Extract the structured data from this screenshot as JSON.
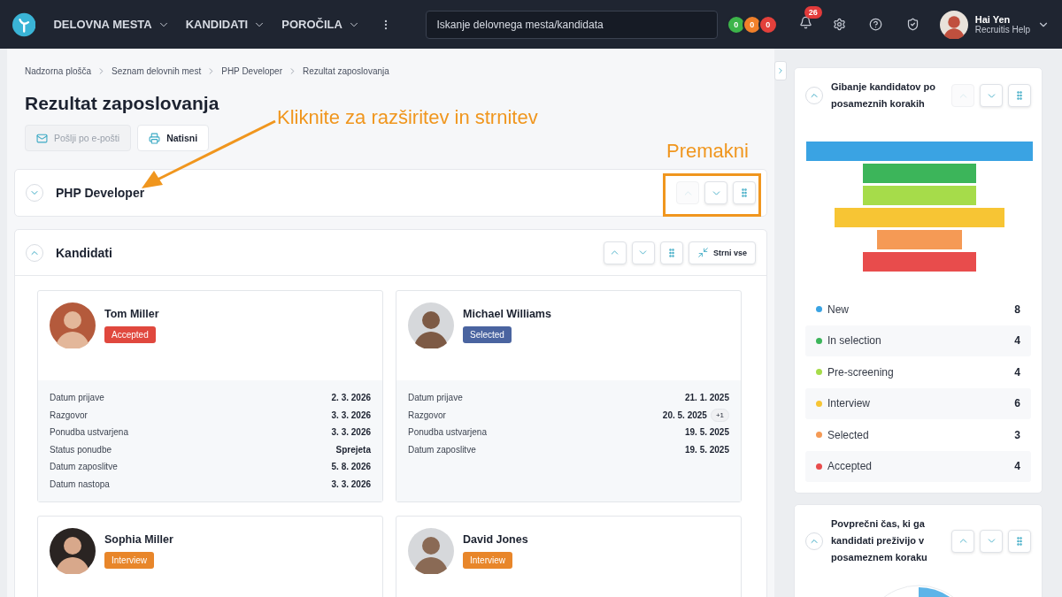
{
  "nav": {
    "menu": [
      {
        "label": "DELOVNA MESTA"
      },
      {
        "label": "KANDIDATI"
      },
      {
        "label": "POROČILA"
      }
    ],
    "search": {
      "placeholder": "Iskanje delovnega mesta/kandidata"
    },
    "counters": [
      {
        "value": "0",
        "color": "#3db54a"
      },
      {
        "value": "0",
        "color": "#f0802a"
      },
      {
        "value": "0",
        "color": "#e3403b"
      }
    ],
    "notifications": "26",
    "user": {
      "name": "Hai Yen",
      "subtitle": "Recruitis Help"
    }
  },
  "breadcrumb": [
    {
      "label": "Nadzorna plošča"
    },
    {
      "label": "Seznam delovnih mest"
    },
    {
      "label": "PHP Developer"
    },
    {
      "label": "Rezultat zaposlovanja"
    }
  ],
  "title": "Rezultat zaposlovanja",
  "actions": [
    {
      "kind": "email",
      "label": "Pošlji po e-pošti",
      "disabled": true
    },
    {
      "kind": "print",
      "label": "Natisni",
      "disabled": false
    }
  ],
  "annotations": {
    "hint": "Kliknite za razširitev in strnitev",
    "move": "Premakni"
  },
  "sections": [
    {
      "title": "PHP Developer",
      "expanded": false,
      "controls": [
        {
          "kind": "up",
          "disabled": true
        },
        {
          "kind": "down",
          "disabled": false
        },
        {
          "kind": "drag",
          "disabled": false
        }
      ]
    },
    {
      "title": "Kandidati",
      "expanded": true,
      "controls": [
        {
          "kind": "up",
          "disabled": false
        },
        {
          "kind": "down",
          "disabled": false
        },
        {
          "kind": "drag",
          "disabled": false
        },
        {
          "kind": "collapse_all",
          "label": "Strni vse",
          "disabled": false
        }
      ]
    }
  ],
  "candidates": [
    {
      "name": "Tom Miller",
      "status": {
        "label": "Accepted",
        "color": "#e0483e"
      },
      "details": [
        {
          "label": "Datum prijave",
          "value": "2. 3. 2026"
        },
        {
          "label": "Razgovor",
          "value": "3. 3. 2026"
        },
        {
          "label": "Ponudba ustvarjena",
          "value": "3. 3. 2026"
        },
        {
          "label": "Status ponudbe",
          "value": "Sprejeta"
        },
        {
          "label": "Datum zaposlitve",
          "value": "5. 8. 2026"
        },
        {
          "label": "Datum nastopa",
          "value": "3. 3. 2026"
        }
      ]
    },
    {
      "name": "Michael Williams",
      "status": {
        "label": "Selected",
        "color": "#4a64a0"
      },
      "details": [
        {
          "label": "Datum prijave",
          "value": "21. 1. 2025"
        },
        {
          "label": "Razgovor",
          "value": "20. 5. 2025",
          "extra": "+1"
        },
        {
          "label": "Ponudba ustvarjena",
          "value": "19. 5. 2025"
        },
        {
          "label": "Datum zaposlitve",
          "value": "19. 5. 2025"
        }
      ]
    },
    {
      "name": "Sophia Miller",
      "status": {
        "label": "Interview",
        "color": "#e8862a"
      }
    },
    {
      "name": "David Jones",
      "status": {
        "label": "Interview",
        "color": "#e8862a"
      }
    }
  ],
  "widgets": [
    {
      "kind": "funnel",
      "title": "Gibanje kandidatov po posameznih korakih",
      "expanded": true,
      "controls": [
        {
          "kind": "up",
          "disabled": true
        },
        {
          "kind": "down",
          "disabled": false
        },
        {
          "kind": "drag",
          "disabled": false
        }
      ],
      "legend": [
        {
          "name": "New",
          "count": "8",
          "color": "#3aa3e3"
        },
        {
          "name": "In selection",
          "count": "4",
          "color": "#3cb55a"
        },
        {
          "name": "Pre-screening",
          "count": "4",
          "color": "#a6dc4a"
        },
        {
          "name": "Interview",
          "count": "6",
          "color": "#f7c534"
        },
        {
          "name": "Selected",
          "count": "3",
          "color": "#f59a55"
        },
        {
          "name": "Accepted",
          "count": "4",
          "color": "#e84c4c"
        }
      ]
    },
    {
      "kind": "polar",
      "title": "Povprečni čas, ki ga kandidati preživijo v posameznem koraku",
      "expanded": true,
      "controls": [
        {
          "kind": "up",
          "disabled": false
        },
        {
          "kind": "down",
          "disabled": false
        },
        {
          "kind": "drag",
          "disabled": false
        }
      ]
    }
  ]
}
